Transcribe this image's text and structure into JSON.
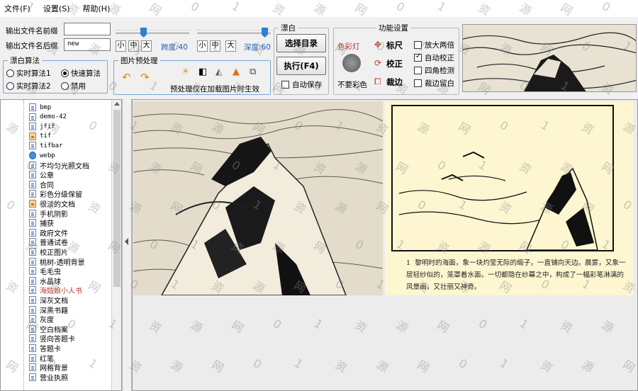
{
  "menu": [
    "文件(F)",
    "设置(S)",
    "帮助(H)"
  ],
  "toolbar": {
    "prefix_label": "输出文件名前缀",
    "prefix_value": "",
    "suffix_label": "输出文件名后缀",
    "suffix_value": "new",
    "size_buttons_1": [
      "小",
      "中",
      "大"
    ],
    "strength_label": "跨度:40",
    "strength_value": 40,
    "size_buttons_2": [
      "小",
      "中",
      "大"
    ],
    "depth_label": "深度:60",
    "depth_value": 60,
    "algo_group": "漂白算法",
    "algo_options": [
      "实时算法1",
      "快速算法",
      "实时算法2",
      "禁用"
    ],
    "algo_selected": "快速算法",
    "preproc_group": "图片预处理",
    "preproc_note": "预处理仅在加载图片时生效",
    "bleach_group": "漂白",
    "select_dir_button": "选择目录",
    "execute_button": "执行(F4)",
    "autosave_label": "自动保存",
    "func_group": "功能设置",
    "color_light_label": "色彩灯",
    "no_color_label": "不要彩色",
    "ruler_button": "标尺",
    "correct_button": "校正",
    "crop_button": "裁边",
    "options": [
      {
        "label": "放大两倍",
        "checked": false
      },
      {
        "label": "自动校正",
        "checked": true
      },
      {
        "label": "四角检测",
        "checked": false
      },
      {
        "label": "裁边留白",
        "checked": false
      }
    ]
  },
  "tree": {
    "items": [
      {
        "label": "bmp",
        "icon": "doc",
        "mono": true
      },
      {
        "label": "demo-42",
        "icon": "doc",
        "mono": true
      },
      {
        "label": "jfif",
        "icon": "doc",
        "mono": true
      },
      {
        "label": "tif",
        "icon": "img",
        "mono": true
      },
      {
        "label": "tifbar",
        "icon": "doc",
        "mono": true
      },
      {
        "label": "webp",
        "icon": "globe",
        "mono": true
      },
      {
        "label": "不均匀光照文档",
        "icon": "doc"
      },
      {
        "label": "公章",
        "icon": "doc"
      },
      {
        "label": "合同",
        "icon": "doc"
      },
      {
        "label": "彩色分级保留",
        "icon": "doc"
      },
      {
        "label": "很淡的文档",
        "icon": "img"
      },
      {
        "label": "手机阴影",
        "icon": "doc"
      },
      {
        "label": "捕获",
        "icon": "doc"
      },
      {
        "label": "政府文件",
        "icon": "doc"
      },
      {
        "label": "普通试卷",
        "icon": "doc"
      },
      {
        "label": "校正图片",
        "icon": "doc"
      },
      {
        "label": "桃树-透明背景",
        "icon": "doc"
      },
      {
        "label": "毛毛虫",
        "icon": "doc"
      },
      {
        "label": "水晶球",
        "icon": "doc"
      },
      {
        "label": "海姑娘小人书",
        "icon": "doc",
        "red": true
      },
      {
        "label": "深灰文档",
        "icon": "doc"
      },
      {
        "label": "深黑书籍",
        "icon": "doc"
      },
      {
        "label": "灰度",
        "icon": "doc"
      },
      {
        "label": "空白档案",
        "icon": "doc"
      },
      {
        "label": "竖向答题卡",
        "icon": "doc"
      },
      {
        "label": "答题卡",
        "icon": "doc"
      },
      {
        "label": "红笔",
        "icon": "doc"
      },
      {
        "label": "网格背景",
        "icon": "doc"
      },
      {
        "label": "营业执照",
        "icon": "doc"
      }
    ]
  },
  "caption": {
    "number": "1",
    "text": "黎明时的海面，象一块灼莹无际的缎子，一直铺向天边。晨雾，又象一层轻纱似的，笼罩着水面。一切都隐在纱幕之中，构成了一幅彩笔淋漓的风景画，又壮丽又神奇。"
  },
  "watermark_text": "01资源网",
  "colors": {
    "accent": "#2f7ed8",
    "group_border": "#7aa7d6",
    "left_image_bg": "#e3dccb",
    "right_image_bg": "#fdf6d0"
  }
}
